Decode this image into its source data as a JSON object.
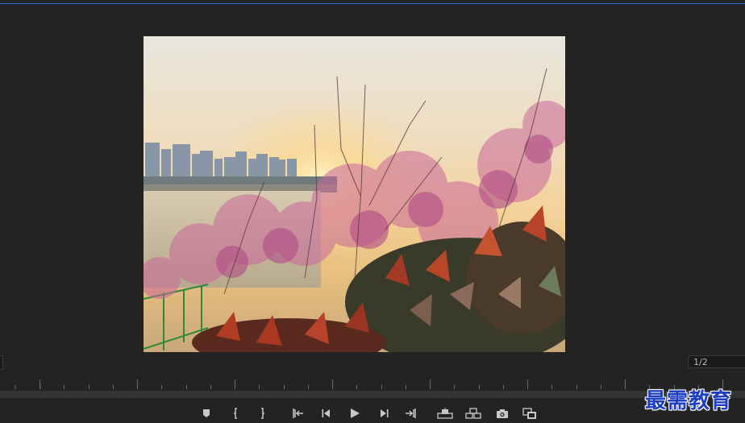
{
  "viewer": {
    "photo": "program-monitor-frame-sunset-redbud-blossoms"
  },
  "playback": {
    "resolution": "1/2"
  },
  "controls": [
    {
      "name": "add-marker-button",
      "icon": "marker-icon"
    },
    {
      "name": "mark-in-button",
      "icon": "mark-in-icon"
    },
    {
      "name": "mark-out-button",
      "icon": "mark-out-icon"
    },
    {
      "name": "go-to-in-button",
      "icon": "go-to-in-icon"
    },
    {
      "name": "step-back-button",
      "icon": "step-back-icon"
    },
    {
      "name": "play-button",
      "icon": "play-icon"
    },
    {
      "name": "step-forward-button",
      "icon": "step-forward-icon"
    },
    {
      "name": "go-to-out-button",
      "icon": "go-to-out-icon"
    },
    {
      "name": "lift-button",
      "icon": "lift-icon"
    },
    {
      "name": "extract-button",
      "icon": "extract-icon"
    },
    {
      "name": "export-frame-button",
      "icon": "camera-icon"
    },
    {
      "name": "comparison-view-button",
      "icon": "comparison-view-icon"
    }
  ],
  "watermark": {
    "text": "最需教育"
  },
  "colors": {
    "panel_bg": "#232323",
    "accent_line": "#2f6fc6",
    "icon": "#c8c8c8",
    "watermark": "#1e3fc2"
  }
}
